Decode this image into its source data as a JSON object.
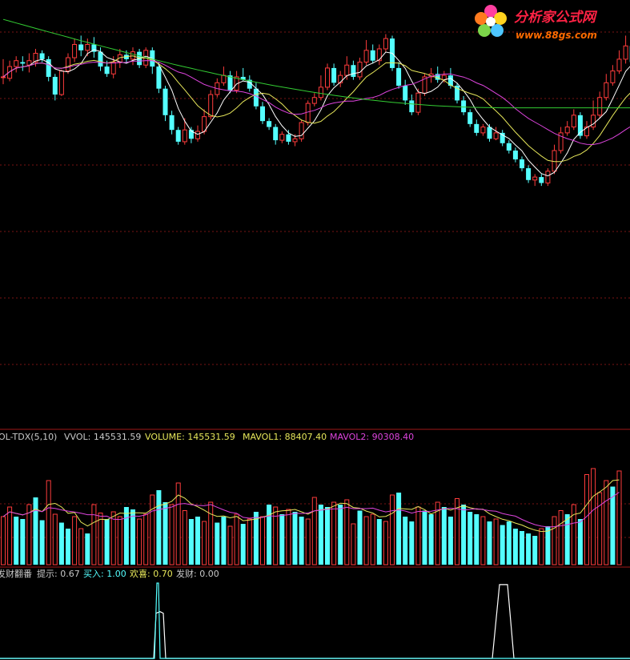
{
  "watermark": {
    "site_name": "分析家公式网",
    "url": "www.88gs.com"
  },
  "colors": {
    "background": "#000000",
    "grid": "#7a1414",
    "divider": "#a01818",
    "up": "#ff3c3c",
    "down": "#54ffff",
    "ma_white": "#ffffff",
    "ma_yellow": "#e6e65a",
    "ma_magenta": "#dd44dd",
    "ma_green": "#33cc33",
    "label_white": "#c8c8c8",
    "label_cyan": "#54ffff",
    "label_magenta": "#dd44dd",
    "label_yellow": "#e6e65a"
  },
  "volume_panel": {
    "label_name": "OL-TDX(5,10)",
    "vvol_label": "VVOL: 145531.59",
    "volume_label": "VOLUME: 145531.59",
    "mavol1_label": "MAVOL1: 88407.40",
    "mavol2_label": "MAVOL2: 90308.40"
  },
  "indicator_panel": {
    "label_name": "发财翻番",
    "tishi_label": "提示: 0.67",
    "mairu_label": "买入: 1.00",
    "huanxi_label": "欢喜: 0.70",
    "facai_label": "发财: 0.00"
  },
  "chart_data": [
    {
      "type": "candlestick",
      "title": "",
      "ylim": [
        0,
        100
      ],
      "candles": [
        [
          56,
          56,
          51,
          68
        ],
        [
          55,
          63,
          53,
          67
        ],
        [
          63,
          67,
          59,
          70
        ],
        [
          66,
          65,
          60,
          70
        ],
        [
          64,
          67,
          59,
          72
        ],
        [
          66,
          72,
          63,
          75
        ],
        [
          72,
          68,
          66,
          74
        ],
        [
          68,
          56,
          53,
          70
        ],
        [
          56,
          44,
          40,
          58
        ],
        [
          44,
          60,
          43,
          61
        ],
        [
          60,
          69,
          58,
          72
        ],
        [
          69,
          78,
          66,
          82
        ],
        [
          78,
          74,
          70,
          84
        ],
        [
          74,
          78,
          70,
          82
        ],
        [
          78,
          73,
          69,
          83
        ],
        [
          73,
          63,
          60,
          76
        ],
        [
          63,
          58,
          56,
          67
        ],
        [
          58,
          66,
          55,
          70
        ],
        [
          66,
          71,
          62,
          75
        ],
        [
          71,
          68,
          65,
          74
        ],
        [
          68,
          73,
          64,
          76
        ],
        [
          73,
          64,
          62,
          75
        ],
        [
          64,
          74,
          62,
          76
        ],
        [
          74,
          63,
          58,
          76
        ],
        [
          63,
          48,
          45,
          66
        ],
        [
          48,
          30,
          26,
          50
        ],
        [
          30,
          20,
          17,
          33
        ],
        [
          20,
          12,
          10,
          22
        ],
        [
          12,
          20,
          10,
          28
        ],
        [
          20,
          14,
          11,
          22
        ],
        [
          14,
          19,
          12,
          23
        ],
        [
          19,
          29,
          17,
          34
        ],
        [
          29,
          44,
          27,
          47
        ],
        [
          44,
          52,
          42,
          55
        ],
        [
          52,
          57,
          50,
          63
        ],
        [
          57,
          47,
          45,
          60
        ],
        [
          47,
          56,
          45,
          60
        ],
        [
          56,
          54,
          53,
          62
        ],
        [
          54,
          48,
          46,
          57
        ],
        [
          48,
          36,
          34,
          52
        ],
        [
          36,
          26,
          24,
          39
        ],
        [
          26,
          22,
          20,
          28
        ],
        [
          22,
          13,
          10,
          24
        ],
        [
          13,
          17,
          11,
          19
        ],
        [
          17,
          12,
          10,
          20
        ],
        [
          12,
          14,
          9,
          17
        ],
        [
          14,
          25,
          12,
          27
        ],
        [
          25,
          38,
          23,
          40
        ],
        [
          38,
          42,
          36,
          45
        ],
        [
          42,
          49,
          40,
          57
        ],
        [
          49,
          62,
          47,
          65
        ],
        [
          62,
          52,
          50,
          65
        ],
        [
          52,
          57,
          49,
          60
        ],
        [
          57,
          64,
          54,
          70
        ],
        [
          64,
          56,
          54,
          67
        ],
        [
          56,
          66,
          54,
          69
        ],
        [
          66,
          74,
          64,
          81
        ],
        [
          74,
          67,
          65,
          78
        ],
        [
          67,
          75,
          64,
          78
        ],
        [
          75,
          82,
          73,
          85
        ],
        [
          82,
          62,
          60,
          84
        ],
        [
          62,
          50,
          48,
          66
        ],
        [
          50,
          40,
          37,
          54
        ],
        [
          40,
          32,
          30,
          44
        ],
        [
          32,
          45,
          30,
          48
        ],
        [
          45,
          56,
          43,
          58
        ],
        [
          56,
          58,
          52,
          62
        ],
        [
          58,
          54,
          52,
          63
        ],
        [
          54,
          57,
          52,
          60
        ],
        [
          57,
          50,
          48,
          62
        ],
        [
          50,
          40,
          38,
          52
        ],
        [
          40,
          32,
          30,
          43
        ],
        [
          32,
          24,
          22,
          34
        ],
        [
          24,
          18,
          16,
          27
        ],
        [
          18,
          22,
          16,
          24
        ],
        [
          22,
          14,
          12,
          24
        ],
        [
          14,
          18,
          13,
          22
        ],
        [
          18,
          11,
          9,
          20
        ],
        [
          11,
          6,
          4,
          13
        ],
        [
          6,
          0,
          -2,
          8
        ],
        [
          0,
          -6,
          -8,
          2
        ],
        [
          -6,
          -14,
          -16,
          -4
        ],
        [
          -14,
          -12,
          -18,
          -10
        ],
        [
          -12,
          -16,
          -18,
          -10
        ],
        [
          -16,
          -8,
          -18,
          -6
        ],
        [
          -8,
          6,
          -10,
          10
        ],
        [
          6,
          18,
          4,
          22
        ],
        [
          18,
          22,
          16,
          26
        ],
        [
          22,
          30,
          20,
          34
        ],
        [
          30,
          16,
          14,
          32
        ],
        [
          16,
          22,
          14,
          26
        ],
        [
          22,
          30,
          20,
          40
        ],
        [
          30,
          42,
          28,
          46
        ],
        [
          42,
          52,
          40,
          58
        ],
        [
          52,
          60,
          50,
          64
        ],
        [
          60,
          68,
          58,
          74
        ],
        [
          68,
          77,
          65,
          84
        ],
        [
          77,
          66,
          64,
          84
        ]
      ]
    },
    {
      "type": "bar",
      "title": "",
      "ylim": [
        0,
        100
      ],
      "volumes": [
        [
          40,
          1
        ],
        [
          48,
          1
        ],
        [
          40,
          0
        ],
        [
          38,
          0
        ],
        [
          50,
          1
        ],
        [
          56,
          0
        ],
        [
          37,
          0
        ],
        [
          70,
          1
        ],
        [
          42,
          1
        ],
        [
          35,
          0
        ],
        [
          30,
          0
        ],
        [
          40,
          1
        ],
        [
          30,
          1
        ],
        [
          26,
          0
        ],
        [
          50,
          1
        ],
        [
          43,
          1
        ],
        [
          38,
          0
        ],
        [
          44,
          1
        ],
        [
          40,
          1
        ],
        [
          48,
          0
        ],
        [
          46,
          0
        ],
        [
          38,
          1
        ],
        [
          42,
          1
        ],
        [
          58,
          1
        ],
        [
          62,
          0
        ],
        [
          52,
          0
        ],
        [
          50,
          1
        ],
        [
          68,
          1
        ],
        [
          45,
          1
        ],
        [
          38,
          0
        ],
        [
          40,
          0
        ],
        [
          36,
          1
        ],
        [
          52,
          1
        ],
        [
          35,
          0
        ],
        [
          40,
          0
        ],
        [
          32,
          1
        ],
        [
          42,
          1
        ],
        [
          34,
          0
        ],
        [
          38,
          1
        ],
        [
          44,
          0
        ],
        [
          40,
          1
        ],
        [
          50,
          0
        ],
        [
          48,
          1
        ],
        [
          42,
          0
        ],
        [
          46,
          1
        ],
        [
          44,
          0
        ],
        [
          40,
          0
        ],
        [
          38,
          1
        ],
        [
          56,
          1
        ],
        [
          50,
          0
        ],
        [
          48,
          0
        ],
        [
          52,
          1
        ],
        [
          50,
          0
        ],
        [
          54,
          1
        ],
        [
          34,
          1
        ],
        [
          45,
          0
        ],
        [
          40,
          1
        ],
        [
          42,
          1
        ],
        [
          38,
          0
        ],
        [
          36,
          1
        ],
        [
          58,
          1
        ],
        [
          60,
          0
        ],
        [
          40,
          0
        ],
        [
          36,
          0
        ],
        [
          48,
          1
        ],
        [
          45,
          0
        ],
        [
          42,
          0
        ],
        [
          52,
          1
        ],
        [
          48,
          0
        ],
        [
          40,
          0
        ],
        [
          55,
          1
        ],
        [
          50,
          0
        ],
        [
          44,
          0
        ],
        [
          42,
          0
        ],
        [
          40,
          1
        ],
        [
          36,
          0
        ],
        [
          38,
          1
        ],
        [
          33,
          0
        ],
        [
          36,
          0
        ],
        [
          30,
          0
        ],
        [
          28,
          0
        ],
        [
          26,
          0
        ],
        [
          24,
          0
        ],
        [
          30,
          1
        ],
        [
          32,
          0
        ],
        [
          40,
          1
        ],
        [
          45,
          1
        ],
        [
          42,
          0
        ],
        [
          50,
          1
        ],
        [
          38,
          0
        ],
        [
          75,
          1
        ],
        [
          80,
          1
        ],
        [
          60,
          1
        ],
        [
          70,
          1
        ],
        [
          65,
          0
        ],
        [
          78,
          1
        ]
      ]
    },
    {
      "type": "line",
      "title": "",
      "ylim": [
        0,
        1
      ],
      "series": [
        {
          "color": "#ffffff",
          "values": [
            [
              0,
              0
            ],
            [
              192,
              0
            ],
            [
              195,
              0.6
            ],
            [
              200,
              0.62
            ],
            [
              204,
              0.6
            ],
            [
              207,
              0
            ],
            [
              615,
              0
            ],
            [
              624,
              0.98
            ],
            [
              634,
              0.98
            ],
            [
              642,
              0
            ],
            [
              787,
              0
            ]
          ]
        },
        {
          "color": "#54ffff",
          "values": [
            [
              0,
              0
            ],
            [
              193,
              0
            ],
            [
              196,
              1
            ],
            [
              198,
              1
            ],
            [
              200,
              0
            ],
            [
              787,
              0
            ]
          ]
        }
      ]
    }
  ]
}
